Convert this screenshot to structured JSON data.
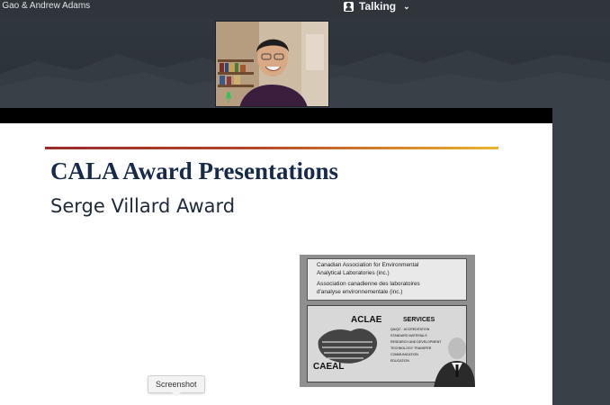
{
  "header": {
    "participants": "e Gao & Andrew Adams",
    "talking_label": "Talking",
    "talking_icon": "person-icon",
    "chevron_icon": "chevron-down-icon"
  },
  "video": {
    "mic_icon": "microphone-icon",
    "mic_color": "#36c25b"
  },
  "slide": {
    "title": "CALA Award Presentations",
    "subtitle": "Serge Villard Award",
    "photo": {
      "sign_top_lines": [
        "Canadian Association for Environmental",
        "Analytical Laboratories (inc.)",
        "Association canadienne des laboratoires",
        "d'analyse environnementale (inc.)"
      ],
      "logo_top": "ACLAE",
      "logo_bottom": "CAEAL",
      "services_title": "SERVICES",
      "services": [
        "QA/QC · ACCREDITATION",
        "STANDARD MATERIALS",
        "RESEARCH AND DEVELOPMENT",
        "TECHNOLOGY TRANSFER",
        "COMMUNICATION",
        "EDUCATION"
      ]
    }
  },
  "tooltip": {
    "label": "Screenshot"
  },
  "colors": {
    "title": "#172a4a",
    "rule_start": "#9c2a2a",
    "rule_end": "#e9b52f"
  }
}
